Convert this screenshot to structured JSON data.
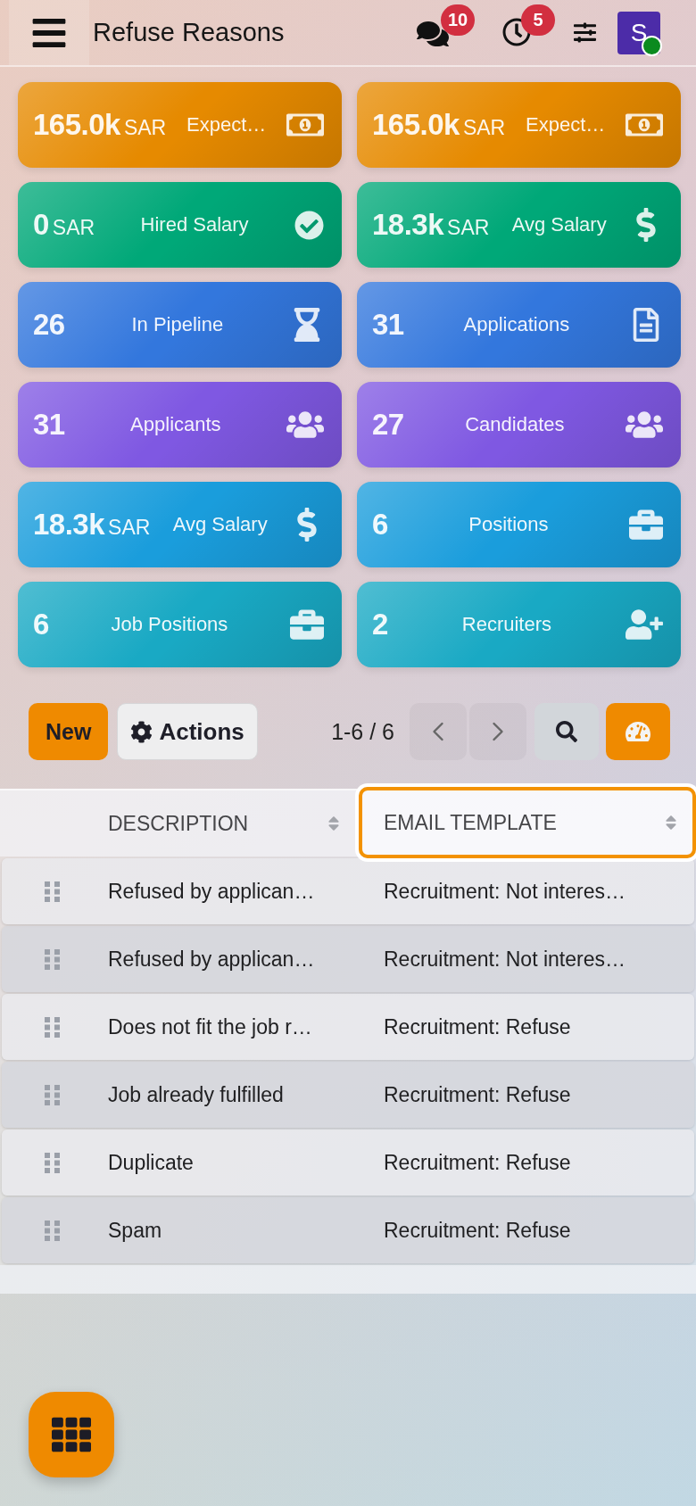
{
  "top_bar": {
    "title": "Refuse Reasons",
    "notifications": [
      {
        "kind": "messages",
        "count": "10"
      },
      {
        "kind": "activities",
        "count": "5"
      }
    ],
    "avatar": {
      "initial": "S",
      "online": true
    }
  },
  "stat_cards": [
    {
      "amount": "165.0k",
      "unit": "SAR",
      "metric": "Expect…",
      "kind": "money",
      "color": "#e68a00"
    },
    {
      "amount": "165.0k",
      "unit": "SAR",
      "metric": "Expect…",
      "kind": "money",
      "color": "#e68a00"
    },
    {
      "amount": "0",
      "unit": "SAR",
      "metric": "Hired Salary",
      "kind": "check",
      "color": "#00a878"
    },
    {
      "amount": "18.3k",
      "unit": "SAR",
      "metric": "Avg Salary",
      "kind": "dollar",
      "color": "#00a878"
    },
    {
      "amount": "26",
      "metric": "In Pipeline",
      "kind": "hourglass",
      "color": "#3377dd"
    },
    {
      "amount": "31",
      "metric": "Applications",
      "kind": "document",
      "color": "#3377dd"
    },
    {
      "amount": "31",
      "metric": "Applicants",
      "kind": "group",
      "color": "#7f58e2"
    },
    {
      "amount": "27",
      "metric": "Candidates",
      "kind": "group",
      "color": "#7f58e2"
    },
    {
      "amount": "18.3k",
      "unit": "SAR",
      "metric": "Avg Salary",
      "kind": "dollar",
      "color": "#1a9ddc"
    },
    {
      "amount": "6",
      "metric": "Positions",
      "kind": "briefcase",
      "color": "#1a9ddc"
    },
    {
      "amount": "6",
      "metric": "Job Positions",
      "kind": "briefcase",
      "color": "#19a9c4"
    },
    {
      "amount": "2",
      "metric": "Recruiters",
      "kind": "adduser",
      "color": "#19a9c4"
    }
  ],
  "control_panel": {
    "new_button": "New",
    "actions_button": "Actions",
    "pager": "1-6 / 6"
  },
  "table": {
    "columns": [
      {
        "label": "DESCRIPTION",
        "focused": false
      },
      {
        "label": "EMAIL TEMPLATE",
        "focused": true
      }
    ],
    "rows": [
      {
        "cells": [
          "Refused by applican…",
          "Recruitment: Not interes…"
        ]
      },
      {
        "cells": [
          "Refused by applican…",
          "Recruitment: Not interes…"
        ]
      },
      {
        "cells": [
          "Does not fit the job r…",
          "Recruitment: Refuse"
        ]
      },
      {
        "cells": [
          "Job already fulfilled",
          "Recruitment: Refuse"
        ]
      },
      {
        "cells": [
          "Duplicate",
          "Recruitment: Refuse"
        ]
      },
      {
        "cells": [
          "Spam",
          "Recruitment: Refuse"
        ]
      }
    ]
  }
}
